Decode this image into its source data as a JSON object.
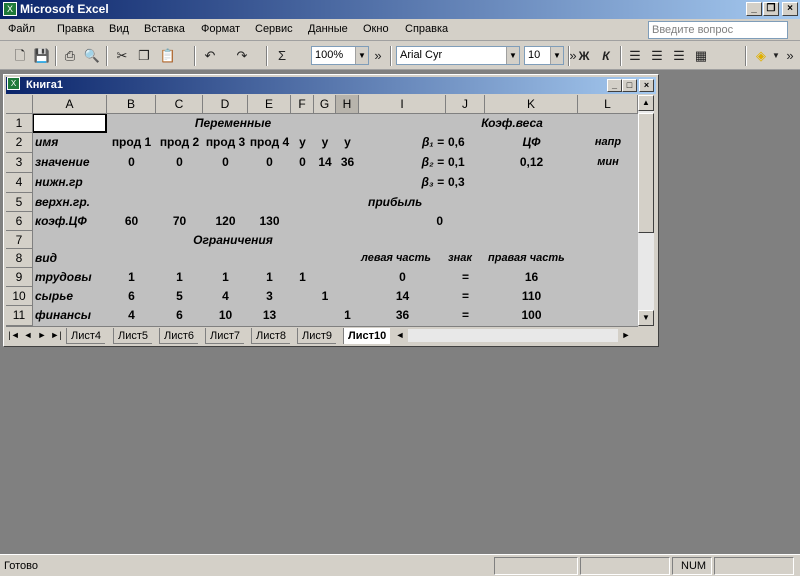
{
  "app": {
    "title": "Microsoft Excel",
    "icon": "excel-icon"
  },
  "window_buttons": [
    "_",
    "❐",
    "×"
  ],
  "menu": [
    "Файл",
    "Правка",
    "Вид",
    "Вставка",
    "Формат",
    "Сервис",
    "Данные",
    "Окно",
    "Справка"
  ],
  "help_box": {
    "placeholder": "Введите вопрос"
  },
  "toolbar": {
    "zoom": "100%",
    "font": "Arial Cyr",
    "size": "10",
    "bold": "Ж",
    "italic": "К",
    "sum": "Σ"
  },
  "workbook": {
    "title": "Книга1"
  },
  "columns": [
    "A",
    "B",
    "C",
    "D",
    "E",
    "F",
    "G",
    "H",
    "I",
    "J",
    "K",
    "L"
  ],
  "rows": [
    "1",
    "2",
    "3",
    "4",
    "5",
    "6",
    "7",
    "8",
    "9",
    "10",
    "11"
  ],
  "cells": {
    "r1": {
      "vars": "Переменные",
      "weights": "Коэф.веса"
    },
    "r2": {
      "A": "имя",
      "B": "прод 1",
      "C": "прод 2",
      "D": "прод 3",
      "E": "прод 4",
      "F": "y",
      "G": "y",
      "H": "y",
      "I": "β₁ =",
      "J": "0,6",
      "K": "ЦФ",
      "L": "напр"
    },
    "r3": {
      "A": "значение",
      "B": "0",
      "C": "0",
      "D": "0",
      "E": "0",
      "F": "0",
      "G": "14",
      "H": "36",
      "I": "β₂ =",
      "J": "0,1",
      "K": "0,12",
      "L": "мин"
    },
    "r4": {
      "A": "нижн.гр",
      "I": "β₃ =",
      "J": "0,3"
    },
    "r5": {
      "A": "верхн.гр.",
      "I": "прибыль"
    },
    "r6": {
      "A": "коэф.ЦФ",
      "B": "60",
      "C": "70",
      "D": "120",
      "E": "130",
      "I": "0"
    },
    "r7": {
      "constraints": "Ограничения"
    },
    "r8": {
      "A": "вид",
      "I": "левая часть",
      "J": "знак",
      "K": "правая часть"
    },
    "r9": {
      "A": "трудовы",
      "B": "1",
      "C": "1",
      "D": "1",
      "E": "1",
      "F": "1",
      "I": "0",
      "J": "=",
      "K": "16"
    },
    "r10": {
      "A": "сырье",
      "B": "6",
      "C": "5",
      "D": "4",
      "E": "3",
      "G": "1",
      "I": "14",
      "J": "=",
      "K": "110"
    },
    "r11": {
      "A": "финансы",
      "B": "4",
      "C": "6",
      "D": "10",
      "E": "13",
      "H": "1",
      "I": "36",
      "J": "=",
      "K": "100"
    }
  },
  "sheet_tabs": [
    "Лист4",
    "Лист5",
    "Лист6",
    "Лист7",
    "Лист8",
    "Лист9",
    "Лист10"
  ],
  "active_sheet": "Лист10",
  "status": {
    "ready": "Готово",
    "num": "NUM"
  }
}
